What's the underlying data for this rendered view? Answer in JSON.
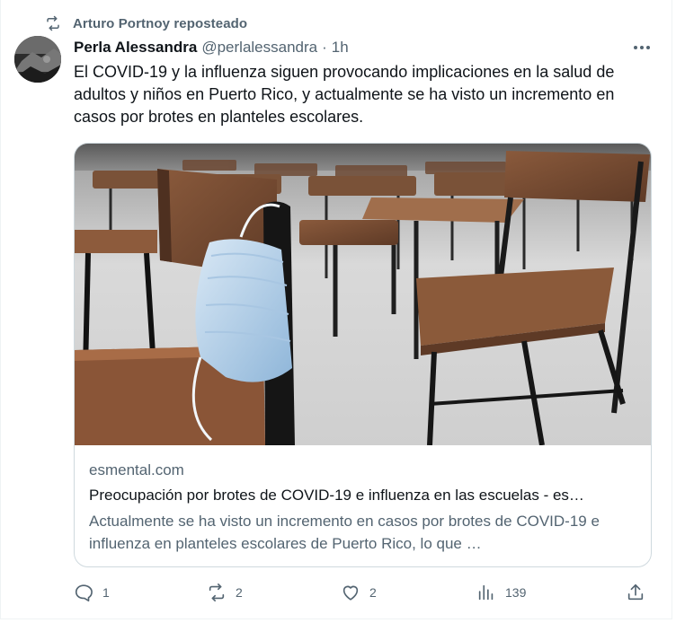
{
  "repost": {
    "icon": "repost-icon",
    "label": "Arturo Portnoy reposteado"
  },
  "tweet": {
    "author_name": "Perla Alessandra",
    "author_handle": "@perlalessandra",
    "separator": "·",
    "time": "1h",
    "text": "El COVID-19 y la influenza siguen provocando implicaciones en la salud de adultos y niños en Puerto Rico, y actualmente se ha visto un incremento en casos por brotes en planteles escolares."
  },
  "card": {
    "domain": "esmental.com",
    "title": "Preocupación por brotes de COVID-19 e influenza en las escuelas - es…",
    "description": "Actualmente se ha visto un incremento en casos por brotes de COVID-19 e influenza en planteles escolares de Puerto Rico, lo que …"
  },
  "actions": {
    "replies": "1",
    "reposts": "2",
    "likes": "2",
    "views": "139"
  },
  "colors": {
    "text_primary": "#0f1419",
    "text_secondary": "#536471",
    "border": "#cfd9de"
  }
}
